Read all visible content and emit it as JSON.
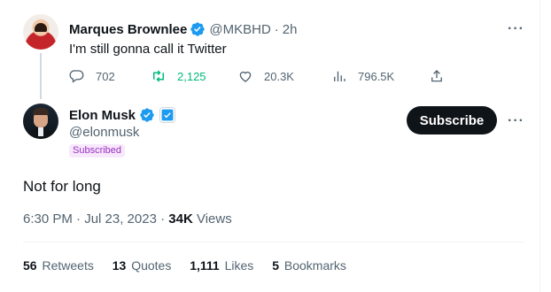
{
  "parent_tweet": {
    "author_name": "Marques Brownlee",
    "handle": "@MKBHD",
    "separator": "·",
    "time": "2h",
    "text": "I'm still gonna call it Twitter",
    "replies": "702",
    "retweets": "2,125",
    "likes": "20.3K",
    "views": "796.5K",
    "more_glyph": "···"
  },
  "main_tweet": {
    "author_name": "Elon Musk",
    "handle": "@elonmusk",
    "subscribed_badge": "Subscribed",
    "subscribe_label": "Subscribe",
    "more_glyph": "···",
    "text": "Not for long",
    "timestamp": "6:30 PM · Jul 23, 2023 ·",
    "views_count": "34K",
    "views_label": "Views",
    "stats": {
      "retweets_count": "56",
      "retweets_label": "Retweets",
      "quotes_count": "13",
      "quotes_label": "Quotes",
      "likes_count": "1,111",
      "likes_label": "Likes",
      "bookmarks_count": "5",
      "bookmarks_label": "Bookmarks"
    }
  },
  "colors": {
    "verified_blue": "#1d9bf0",
    "retweet_green": "#00ba7c",
    "secondary_text": "#536471",
    "subscribed_purple": "#9b2ec2"
  },
  "icons": [
    "verified-badge-icon",
    "reply-icon",
    "retweet-icon",
    "like-icon",
    "views-icon",
    "share-icon",
    "affiliation-x-icon",
    "more-icon"
  ]
}
